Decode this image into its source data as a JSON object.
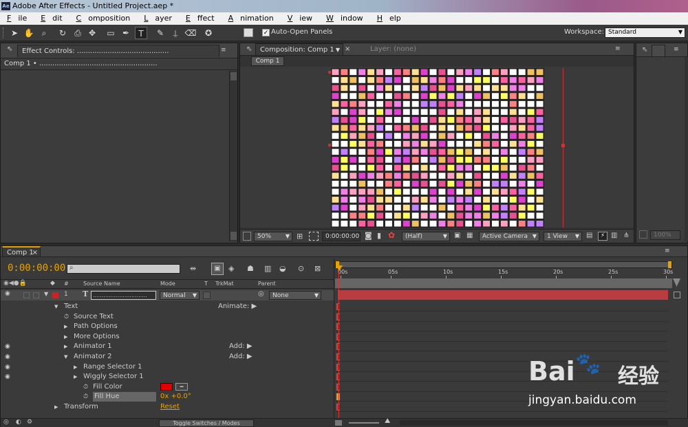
{
  "window": {
    "title": "Adobe After Effects - Untitled Project.aep *",
    "app_icon": "Ae"
  },
  "menu": [
    {
      "label": "File",
      "u": "F",
      "rest": "ile"
    },
    {
      "label": "Edit",
      "u": "E",
      "rest": "dit"
    },
    {
      "label": "Composition",
      "u": "C",
      "rest": "omposition"
    },
    {
      "label": "Layer",
      "u": "L",
      "rest": "ayer"
    },
    {
      "label": "Effect",
      "u": "E",
      "rest": "ffect"
    },
    {
      "label": "Animation",
      "u": "A",
      "rest": "nimation"
    },
    {
      "label": "View",
      "u": "V",
      "rest": "iew"
    },
    {
      "label": "Window",
      "u": "W",
      "rest": "indow"
    },
    {
      "label": "Help",
      "u": "H",
      "rest": "elp"
    }
  ],
  "toolbar": {
    "tools": [
      "selection-icon",
      "hand-icon",
      "zoom-icon",
      "rotate-icon",
      "camera-icon",
      "pan-behind-icon",
      "rectangle-icon",
      "pen-icon",
      "text-icon",
      "brush-icon",
      "clone-stamp-icon",
      "eraser-icon",
      "puppet-pin-icon"
    ],
    "auto_open_label": "Auto-Open Panels",
    "auto_open_checked": true,
    "workspace_label": "Workspace:",
    "workspace_value": "Standard"
  },
  "effect_controls": {
    "tab": "Effect Controls: ..........................................",
    "subtitle": "Comp 1 • ......................................................"
  },
  "composition": {
    "tab": "Composition: Comp 1",
    "layer_tab": "Layer: (none)",
    "crumb": "Comp 1",
    "zoom": "50%",
    "timecode": "0:00:00:00",
    "resolution": "(Half)",
    "camera": "Active Camera",
    "views": "1 View",
    "grid_colors": [
      "#ffffff",
      "#ffffff",
      "#ffffff",
      "#f080e8",
      "#e040d0",
      "#ffff60",
      "#ffe090",
      "#ffa0c0",
      "#ff8080",
      "#e85090",
      "#c080ff",
      "#ffffff",
      "#ffffff",
      "#ff60a0",
      "#f0c060"
    ]
  },
  "right_panel": {
    "zoom": "100%"
  },
  "timeline": {
    "tab": "Comp 1",
    "timecode": "0:00:00:00",
    "search_placeholder": "",
    "columns": {
      "num": "#",
      "source": "Source Name",
      "mode": "Mode",
      "t": "T",
      "trkmat": "TrkMat",
      "parent": "Parent"
    },
    "layer": {
      "num": "1",
      "type": "T",
      "name": "...............................",
      "mode": "Normal",
      "parent": "None"
    },
    "rows": [
      {
        "label": "Text",
        "indent": 1,
        "tri": "down",
        "eye": false,
        "extra": "Animate:"
      },
      {
        "label": "Source Text",
        "indent": 2,
        "stopwatch": true,
        "eye": false
      },
      {
        "label": "Path Options",
        "indent": 2,
        "tri": "right",
        "eye": false
      },
      {
        "label": "More Options",
        "indent": 2,
        "tri": "right",
        "eye": false
      },
      {
        "label": "Animator 1",
        "indent": 2,
        "tri": "right",
        "eye": true,
        "extra": "Add:"
      },
      {
        "label": "Animator 2",
        "indent": 2,
        "tri": "down",
        "eye": true,
        "extra": "Add:"
      },
      {
        "label": "Range Selector 1",
        "indent": 3,
        "tri": "right",
        "eye": true
      },
      {
        "label": "Wiggly Selector 1",
        "indent": 3,
        "tri": "right",
        "eye": true
      },
      {
        "label": "Fill Color",
        "indent": 4,
        "stopwatch": true,
        "eye": false,
        "swatch": "#e00000"
      },
      {
        "label": "Fill Hue",
        "indent": 4,
        "stopwatch": true,
        "eye": false,
        "value": "0x +0.0°",
        "selected": true
      },
      {
        "label": "Transform",
        "indent": 1,
        "tri": "right",
        "eye": false,
        "reset": "Reset"
      }
    ],
    "ruler": [
      "00s",
      "05s",
      "10s",
      "15s",
      "20s",
      "25s",
      "30s"
    ],
    "toggle_label": "Toggle Switches / Modes"
  },
  "watermark": {
    "text": "Bai",
    "text2": "经验",
    "url": "jingyan.baidu.com"
  }
}
